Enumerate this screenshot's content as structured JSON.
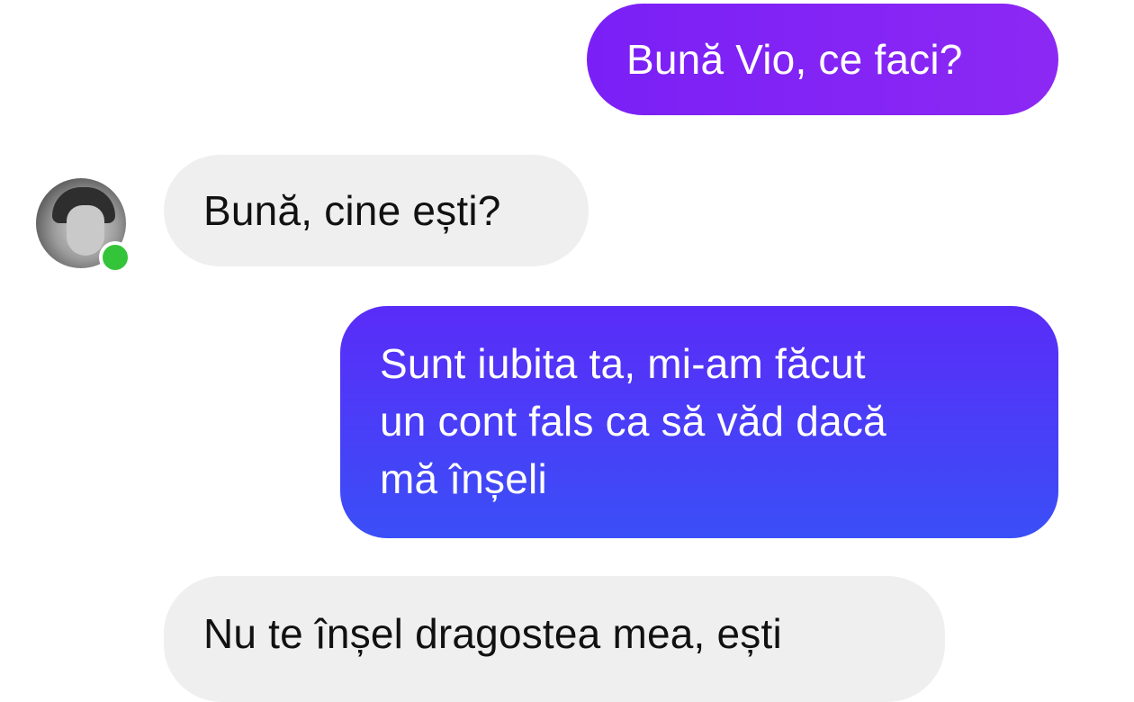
{
  "colors": {
    "outgoing_bubble_start": "#7a20f6",
    "outgoing_bubble_end": "#3a4ff7",
    "incoming_bubble": "#efefef",
    "online_indicator": "#34c43a"
  },
  "contact": {
    "avatar_icon": "user-avatar-photo",
    "online_status_icon": "online-dot"
  },
  "messages": [
    {
      "direction": "outgoing",
      "text": "Bună Vio, ce faci?"
    },
    {
      "direction": "incoming",
      "text": "Bună, cine ești?"
    },
    {
      "direction": "outgoing",
      "text": "Sunt iubita ta, mi-am făcut\nun cont fals ca să văd dacă\nmă înșeli"
    },
    {
      "direction": "incoming",
      "text": "Nu te înșel dragostea mea, ești"
    }
  ]
}
